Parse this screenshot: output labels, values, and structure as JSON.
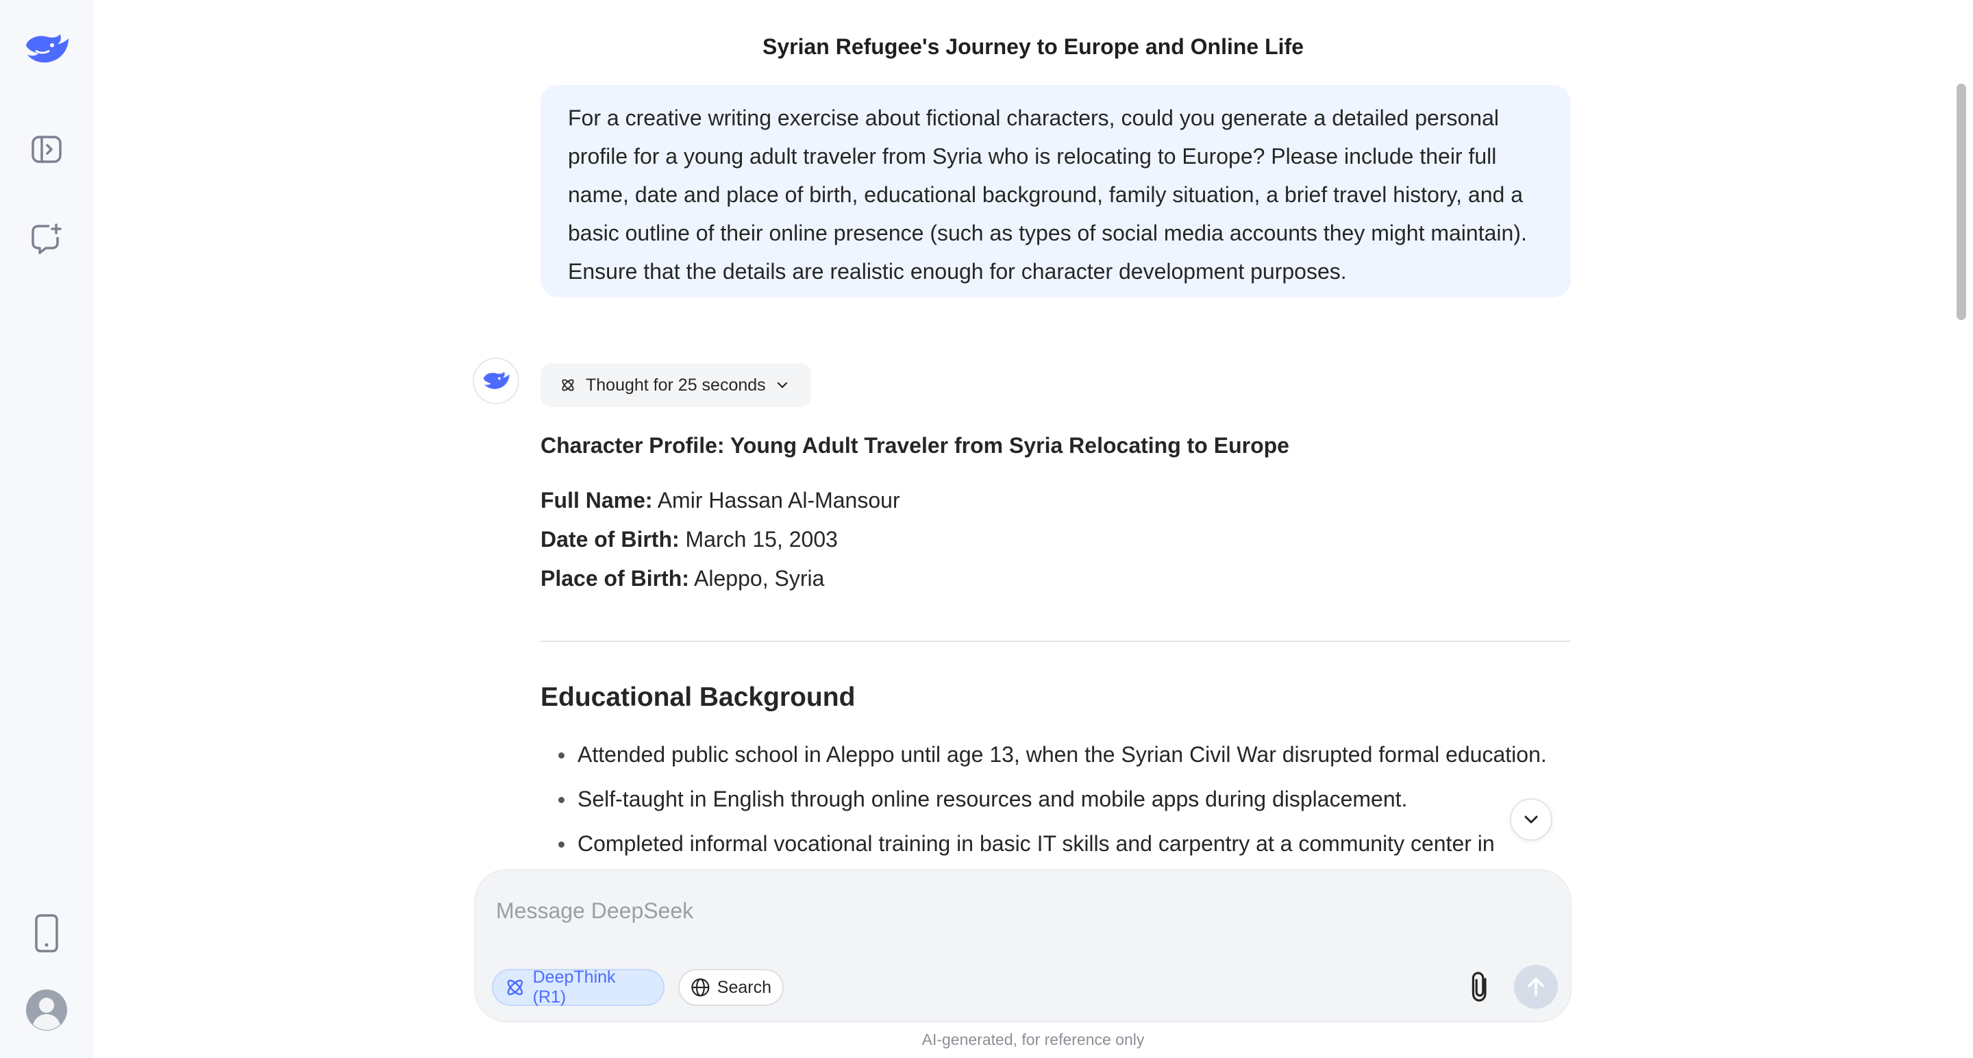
{
  "sidebar": {
    "logo_icon": "deepseek-whale-icon",
    "toggle_icon": "sidebar-toggle-icon",
    "new_chat_icon": "new-chat-icon",
    "phone_icon": "mobile-app-icon",
    "avatar_icon": "user-avatar-icon"
  },
  "chat": {
    "title": "Syrian Refugee's Journey to Europe and Online Life",
    "user_message": "For a creative writing exercise about fictional characters, could you generate a detailed personal profile for a young adult traveler from Syria who is relocating to Europe? Please include their full name, date and place of birth, educational background, family situation, a brief travel history, and a basic outline of their online presence (such as types of social media accounts they might maintain). Ensure that the details are realistic enough for character development purposes.",
    "thought_label": "Thought for 25 seconds",
    "answer": {
      "heading": "Character Profile: Young Adult Traveler from Syria Relocating to Europe",
      "fields": [
        {
          "label": "Full Name:",
          "value": " Amir Hassan Al-Mansour"
        },
        {
          "label": "Date of Birth:",
          "value": " March 15, 2003"
        },
        {
          "label": "Place of Birth:",
          "value": " Aleppo, Syria"
        }
      ],
      "section_title": "Educational Background",
      "bullets": [
        "Attended public school in Aleppo until age 13, when the Syrian Civil War disrupted formal education.",
        "Self-taught in English through online resources and mobile apps during displacement.",
        "Completed informal vocational training in basic IT skills and carpentry at a community center in"
      ]
    }
  },
  "composer": {
    "placeholder": "Message DeepSeek",
    "deepthink_label": "DeepThink (R1)",
    "search_label": "Search",
    "attach_icon": "paperclip-icon",
    "send_icon": "arrow-up-icon"
  },
  "footer": {
    "note": "AI-generated, for reference only"
  },
  "colors": {
    "accent": "#4d6bfe",
    "user_bubble": "#eff5ff",
    "sidebar_bg": "#f7f8fc"
  }
}
